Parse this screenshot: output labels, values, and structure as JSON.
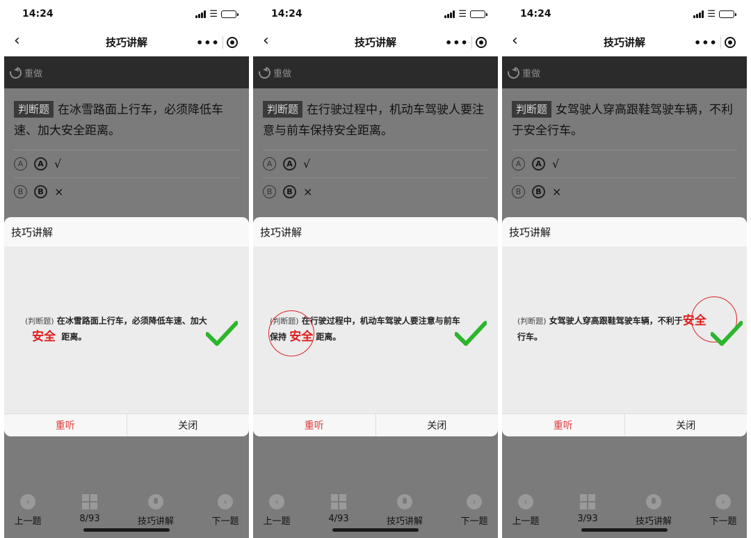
{
  "screens": [
    {
      "status_time": "14:24",
      "nav_title": "技巧讲解",
      "redo_label": "重做",
      "question_tag": "判断题",
      "question_text": "在冰雪路面上行车，必须降低车速、加大安全距离。",
      "option_a": "√",
      "option_b": "×",
      "modal_title": "技巧讲解",
      "explanation_tag": "(判断题)",
      "explanation_text": "在冰雪路面上行车，必须降低车速、加大",
      "answer_word": "安全",
      "explanation_tail": "距离。",
      "replay_label": "重听",
      "close_label": "关闭",
      "prev_label": "上一题",
      "progress": "8/93",
      "tips_label": "技巧讲解",
      "next_label": "下一题"
    },
    {
      "status_time": "14:24",
      "nav_title": "技巧讲解",
      "redo_label": "重做",
      "question_tag": "判断题",
      "question_text": "在行驶过程中，机动车驾驶人要注意与前车保持安全距离。",
      "option_a": "√",
      "option_b": "×",
      "modal_title": "技巧讲解",
      "explanation_tag": "(判断题)",
      "explanation_text": "在行驶过程中，机动车驾驶人要注意与前车",
      "explanation_line2_head": "保持",
      "answer_word": "安全",
      "explanation_tail": "距离。",
      "replay_label": "重听",
      "close_label": "关闭",
      "prev_label": "上一题",
      "progress": "4/93",
      "tips_label": "技巧讲解",
      "next_label": "下一题"
    },
    {
      "status_time": "14:24",
      "nav_title": "技巧讲解",
      "redo_label": "重做",
      "question_tag": "判断题",
      "question_text": "女驾驶人穿高跟鞋驾驶车辆，不利于安全行车。",
      "option_a": "√",
      "option_b": "×",
      "modal_title": "技巧讲解",
      "explanation_tag": "(判断题)",
      "explanation_text": "女驾驶人穿高跟鞋驾驶车辆，不利于",
      "answer_word": "安全",
      "explanation_tail": "行车。",
      "replay_label": "重听",
      "close_label": "关闭",
      "prev_label": "上一题",
      "progress": "3/93",
      "tips_label": "技巧讲解",
      "next_label": "下一题"
    }
  ],
  "option_letters": {
    "a": "A",
    "b": "B"
  },
  "colors": {
    "overlay": "#7b7b7b",
    "toolbar": "#2b2b2b",
    "answer_red": "#e21b1b",
    "replay_red": "#e23b3b",
    "check_green": "#2db52d"
  },
  "icons": [
    "back-chevron-icon",
    "more-icon",
    "target-icon",
    "redo-icon",
    "check-icon",
    "prev-icon",
    "grid-icon",
    "mic-icon",
    "next-icon"
  ]
}
